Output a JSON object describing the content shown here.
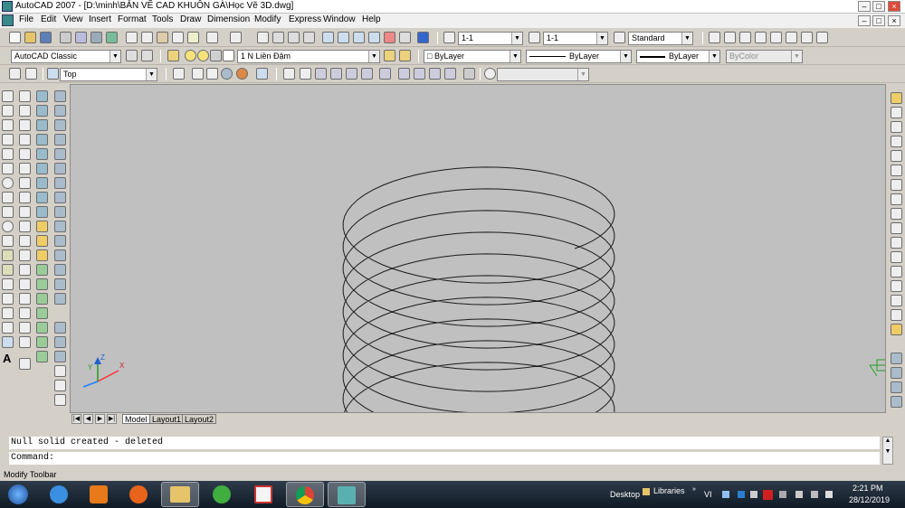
{
  "window": {
    "title": "AutoCAD 2007 - [D:\\minh\\BẢN VẼ CAD KHUÔN GÀ\\Học Vẽ  3D.dwg]"
  },
  "menu": [
    "File",
    "Edit",
    "View",
    "Insert",
    "Format",
    "Tools",
    "Draw",
    "Dimension",
    "Modify",
    "Express",
    "Window",
    "Help"
  ],
  "toolbar1": {
    "textstyle": "1-1",
    "dimstyle": "1-1",
    "tablestyle": "Standard"
  },
  "toolbar2": {
    "workspace": "AutoCAD Classic",
    "layer": "1 N Liền Đậm",
    "color": "ByLayer",
    "linetype": "ByLayer",
    "lineweight": "ByLayer",
    "plotstyle": "ByColor"
  },
  "toolbar3": {
    "view": "Top"
  },
  "tabs": {
    "model": "Model",
    "layout1": "Layout1",
    "layout2": "Layout2"
  },
  "command": {
    "history": "Null solid created - deleted",
    "prompt": "Command:"
  },
  "status": {
    "text": "Modify Toolbar"
  },
  "ucs": {
    "x": "X",
    "y": "Y",
    "z": "Z"
  },
  "taskbar": {
    "desktop": "Desktop",
    "libraries": "Libraries",
    "lang": "VI",
    "time": "2:21 PM",
    "date": "28/12/2019",
    "apps": [
      "start",
      "internet-explorer",
      "media-player",
      "firefox",
      "file-explorer",
      "coccoc",
      "paint",
      "chrome",
      "autocad"
    ]
  },
  "drawing": {
    "type": "helix",
    "turns": 10
  }
}
